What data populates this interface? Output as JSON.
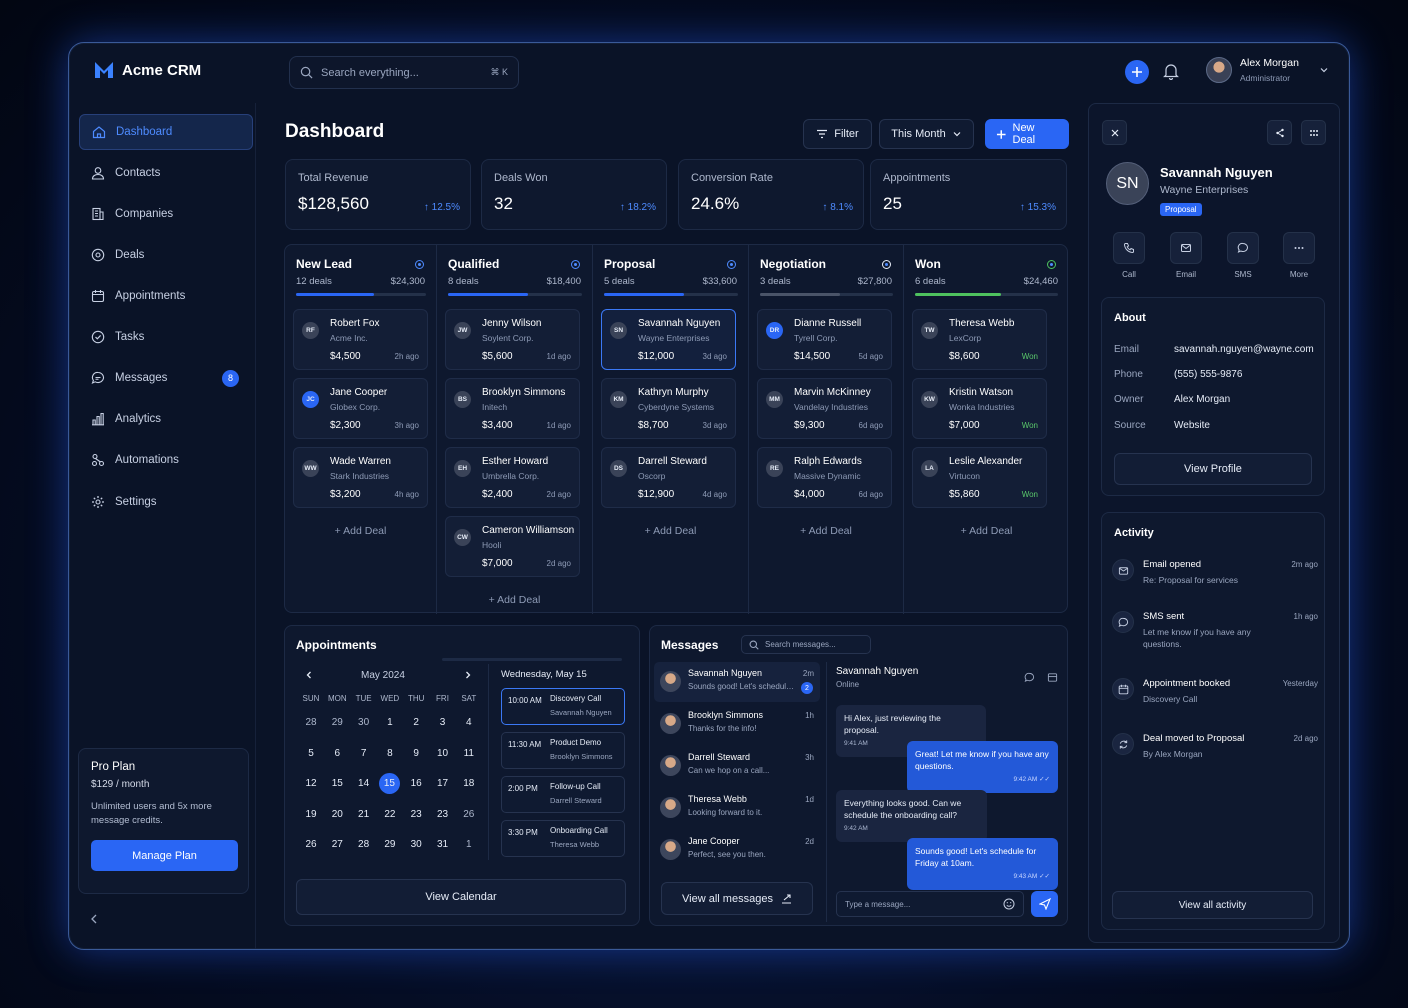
{
  "app": {
    "name": "Acme CRM"
  },
  "search": {
    "placeholder": "Search everything...",
    "shortcut": "⌘ K"
  },
  "user": {
    "name": "Alex Morgan",
    "role": "Administrator"
  },
  "sidebar": {
    "items": [
      {
        "label": "Dashboard",
        "icon": "home-icon",
        "active": true
      },
      {
        "label": "Contacts",
        "icon": "user-icon"
      },
      {
        "label": "Companies",
        "icon": "building-icon"
      },
      {
        "label": "Deals",
        "icon": "dollar-icon"
      },
      {
        "label": "Appointments",
        "icon": "calendar-icon"
      },
      {
        "label": "Tasks",
        "icon": "check-circle-icon"
      },
      {
        "label": "Messages",
        "icon": "chat-icon",
        "badge": "8"
      },
      {
        "label": "Analytics",
        "icon": "bar-chart-icon"
      },
      {
        "label": "Automations",
        "icon": "flow-icon"
      },
      {
        "label": "Settings",
        "icon": "gear-icon"
      }
    ],
    "plan": {
      "title": "Pro Plan",
      "price": "$129 / month",
      "desc": "Unlimited users and 5x more message credits.",
      "button": "Manage Plan"
    }
  },
  "header": {
    "title": "Dashboard",
    "filter": "Filter",
    "period": "This Month",
    "new_deal": "New Deal"
  },
  "stats": [
    {
      "label": "Total Revenue",
      "value": "$128,560",
      "change": "12.5%"
    },
    {
      "label": "Deals Won",
      "value": "32",
      "change": "18.2%"
    },
    {
      "label": "Conversion Rate",
      "value": "24.6%",
      "change": "8.1%"
    },
    {
      "label": "Appointments",
      "value": "25",
      "change": "15.3%"
    }
  ],
  "pipeline": [
    {
      "stage": "New Lead",
      "count": "12 deals",
      "total": "$24,300",
      "progress": 0.6,
      "color": "#2a66f4",
      "deals": [
        {
          "initials": "RF",
          "name": "Robert Fox",
          "company": "Acme Inc.",
          "amount": "$4,500",
          "time": "2h ago"
        },
        {
          "initials": "JC",
          "name": "Jane Cooper",
          "company": "Globex Corp.",
          "amount": "$2,300",
          "time": "3h ago",
          "blue": true
        },
        {
          "initials": "WW",
          "name": "Wade Warren",
          "company": "Stark Industries",
          "amount": "$3,200",
          "time": "4h ago"
        }
      ],
      "add": "Add Deal"
    },
    {
      "stage": "Qualified",
      "count": "8 deals",
      "total": "$18,400",
      "progress": 0.6,
      "color": "#2a66f4",
      "deals": [
        {
          "initials": "JW",
          "name": "Jenny Wilson",
          "company": "Soylent Corp.",
          "amount": "$5,600",
          "time": "1d ago"
        },
        {
          "initials": "BS",
          "name": "Brooklyn Simmons",
          "company": "Initech",
          "amount": "$3,400",
          "time": "1d ago"
        },
        {
          "initials": "EH",
          "name": "Esther Howard",
          "company": "Umbrella Corp.",
          "amount": "$2,400",
          "time": "2d ago"
        },
        {
          "initials": "CW",
          "name": "Cameron Williamson",
          "company": "Hooli",
          "amount": "$7,000",
          "time": "2d ago"
        }
      ],
      "add": "Add Deal"
    },
    {
      "stage": "Proposal",
      "count": "5 deals",
      "total": "$33,600",
      "progress": 0.6,
      "color": "#2a66f4",
      "deals": [
        {
          "initials": "SN",
          "name": "Savannah Nguyen",
          "company": "Wayne Enterprises",
          "amount": "$12,000",
          "time": "3d ago",
          "selected": true
        },
        {
          "initials": "KM",
          "name": "Kathryn Murphy",
          "company": "Cyberdyne Systems",
          "amount": "$8,700",
          "time": "3d ago"
        },
        {
          "initials": "DS",
          "name": "Darrell Steward",
          "company": "Oscorp",
          "amount": "$12,900",
          "time": "4d ago"
        }
      ],
      "add": "Add Deal"
    },
    {
      "stage": "Negotiation",
      "count": "3 deals",
      "total": "$27,800",
      "progress": 0.6,
      "color": "#4a5468",
      "deals": [
        {
          "initials": "DR",
          "name": "Dianne Russell",
          "company": "Tyrell Corp.",
          "amount": "$14,500",
          "time": "5d ago",
          "blue": true
        },
        {
          "initials": "MM",
          "name": "Marvin McKinney",
          "company": "Vandelay Industries",
          "amount": "$9,300",
          "time": "6d ago"
        },
        {
          "initials": "RE",
          "name": "Ralph Edwards",
          "company": "Massive Dynamic",
          "amount": "$4,000",
          "time": "6d ago"
        }
      ],
      "add": "Add Deal"
    },
    {
      "stage": "Won",
      "count": "6 deals",
      "total": "$24,460",
      "progress": 0.6,
      "color": "#4ec25e",
      "deals": [
        {
          "initials": "TW",
          "name": "Theresa Webb",
          "company": "LexCorp",
          "amount": "$8,600",
          "won": "Won"
        },
        {
          "initials": "KW",
          "name": "Kristin Watson",
          "company": "Wonka Industries",
          "amount": "$7,000",
          "won": "Won"
        },
        {
          "initials": "LA",
          "name": "Leslie Alexander",
          "company": "Virtucon",
          "amount": "$5,860",
          "won": "Won"
        }
      ],
      "add": "Add Deal"
    }
  ],
  "appointments": {
    "title": "Appointments",
    "month": "May 2024",
    "dow": [
      "SUN",
      "MON",
      "TUE",
      "WED",
      "THU",
      "FRI",
      "SAT"
    ],
    "weeks": [
      [
        "28",
        "29",
        "30",
        "1",
        "2",
        "3",
        "4"
      ],
      [
        "5",
        "6",
        "7",
        "8",
        "9",
        "10",
        "11"
      ],
      [
        "12",
        "15",
        "14",
        "15",
        "16",
        "17",
        "18"
      ],
      [
        "19",
        "20",
        "21",
        "22",
        "23",
        "23",
        "26"
      ],
      [
        "26",
        "27",
        "28",
        "29",
        "30",
        "31",
        "1"
      ]
    ],
    "selected_day": "15",
    "day_title": "Wednesday, May 15",
    "slots": [
      {
        "time": "10:00 AM",
        "title": "Discovery Call",
        "who": "Savannah Nguyen"
      },
      {
        "time": "11:30 AM",
        "title": "Product Demo",
        "who": "Brooklyn Simmons"
      },
      {
        "time": "2:00 PM",
        "title": "Follow-up Call",
        "who": "Darrell Steward"
      },
      {
        "time": "3:30 PM",
        "title": "Onboarding Call",
        "who": "Theresa Webb"
      }
    ],
    "view_button": "View Calendar"
  },
  "messages": {
    "title": "Messages",
    "search_placeholder": "Search messages...",
    "threads": [
      {
        "name": "Savannah Nguyen",
        "snippet": "Sounds good! Let's schedule...",
        "time": "2m",
        "unread": "2"
      },
      {
        "name": "Brooklyn Simmons",
        "snippet": "Thanks for the info!",
        "time": "1h"
      },
      {
        "name": "Darrell Steward",
        "snippet": "Can we hop on a call...",
        "time": "3h"
      },
      {
        "name": "Theresa Webb",
        "snippet": "Looking forward to it.",
        "time": "1d"
      },
      {
        "name": "Jane Cooper",
        "snippet": "Perfect, see you then.",
        "time": "2d"
      }
    ],
    "view_all": "View all messages",
    "chat": {
      "name": "Savannah Nguyen",
      "status": "Online",
      "bubbles": [
        {
          "dir": "in",
          "text": "Hi Alex, just reviewing the proposal.",
          "time": "9:41 AM"
        },
        {
          "dir": "out",
          "text": "Great! Let me know if you have any questions.",
          "time": "9:42 AM ✓✓"
        },
        {
          "dir": "in",
          "text": "Everything looks good. Can we schedule the onboarding call?",
          "time": "9:42 AM"
        },
        {
          "dir": "out",
          "text": "Sounds good! Let's schedule for Friday at 10am.",
          "time": "9:43 AM ✓✓"
        }
      ],
      "input_placeholder": "Type a message..."
    }
  },
  "contact": {
    "initials": "SN",
    "name": "Savannah Nguyen",
    "company": "Wayne Enterprises",
    "stage": "Proposal",
    "actions": [
      "Call",
      "Email",
      "SMS",
      "More"
    ],
    "about_title": "About",
    "about": [
      {
        "k": "Email",
        "v": "savannah.nguyen@wayne.com"
      },
      {
        "k": "Phone",
        "v": "(555) 555-9876"
      },
      {
        "k": "Owner",
        "v": "Alex Morgan"
      },
      {
        "k": "Source",
        "v": "Website"
      }
    ],
    "view_profile": "View Profile",
    "activity_title": "Activity",
    "activity": [
      {
        "title": "Email opened",
        "sub": "Re: Proposal for services",
        "time": "2m ago",
        "icon": "mail-open-icon"
      },
      {
        "title": "SMS sent",
        "sub": "Let me know if you have any questions.",
        "time": "1h ago",
        "icon": "sms-icon"
      },
      {
        "title": "Appointment booked",
        "sub": "Discovery Call",
        "time": "Yesterday",
        "icon": "calendar-icon"
      },
      {
        "title": "Deal moved to Proposal",
        "sub": "By Alex Morgan",
        "time": "2d ago",
        "icon": "refresh-icon"
      }
    ],
    "view_activity": "View all activity"
  }
}
